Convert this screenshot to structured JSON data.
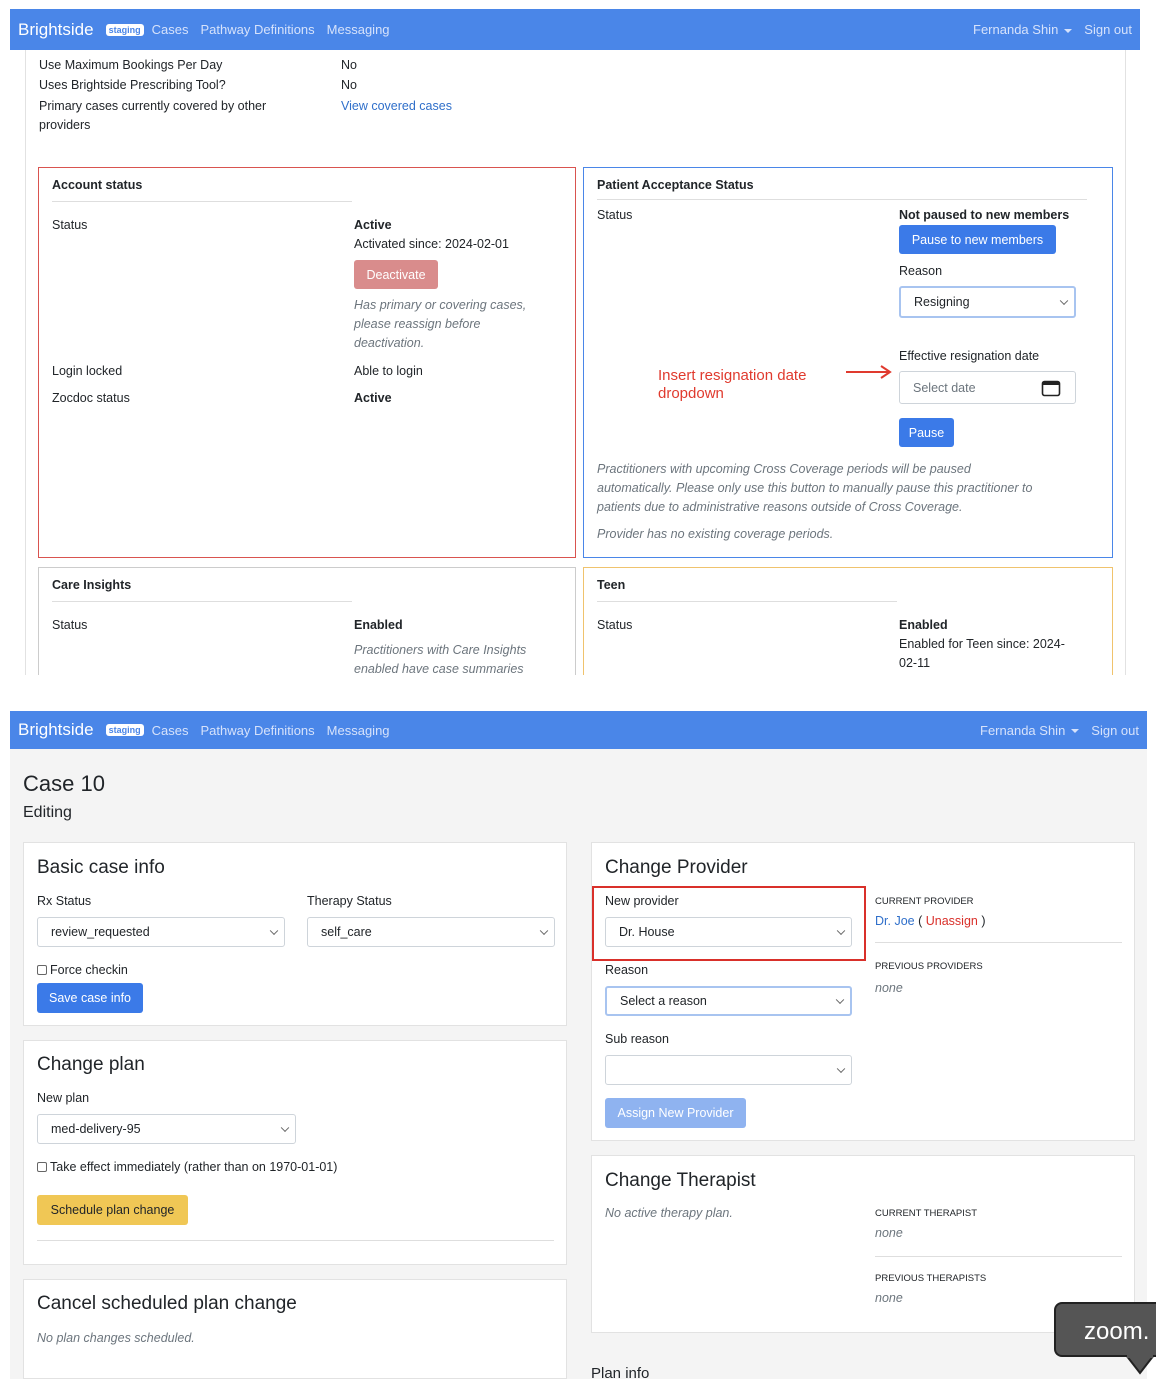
{
  "nav": {
    "brand": "Brightside",
    "env_badge": "staging",
    "links": [
      "Cases",
      "Pathway Definitions",
      "Messaging"
    ],
    "user": "Fernanda Shin",
    "sign_out": "Sign out"
  },
  "screen1": {
    "details": {
      "max_bookings_label": "Use Maximum Bookings Per Day",
      "max_bookings_value": "No",
      "prescribing_label": "Uses Brightside Prescribing Tool?",
      "prescribing_value": "No",
      "covered_label_1": "Primary cases currently covered by other",
      "covered_label_2": "providers",
      "covered_link": "View covered cases"
    },
    "account_status": {
      "title": "Account status",
      "status_label": "Status",
      "status_value": "Active",
      "activated_since": "Activated since: 2024-02-01",
      "deactivate_button": "Deactivate",
      "deactivate_note_1": "Has primary or covering cases,",
      "deactivate_note_2": "please reassign before",
      "deactivate_note_3": "deactivation.",
      "login_locked_label": "Login locked",
      "login_locked_value": "Able to login",
      "zocdoc_label": "Zocdoc status",
      "zocdoc_value": "Active"
    },
    "patient_acceptance": {
      "title": "Patient Acceptance Status",
      "status_label": "Status",
      "status_value": "Not paused to new members",
      "pause_new_button": "Pause to new members",
      "reason_label": "Reason",
      "reason_value": "Resigning",
      "date_label": "Effective resignation date",
      "date_placeholder": "Select date",
      "pause_button": "Pause",
      "annotation_1": "Insert resignation date",
      "annotation_2": "dropdown",
      "note_1": "Practitioners with upcoming Cross Coverage periods will be paused",
      "note_2": "automatically. Please only use this button to manually pause this practitioner to",
      "note_3": "patients due to administrative reasons outside of Cross Coverage.",
      "coverage_note": "Provider has no existing coverage periods."
    },
    "care_insights": {
      "title": "Care Insights",
      "status_label": "Status",
      "status_value": "Enabled",
      "note_1": "Practitioners with Care Insights",
      "note_2": "enabled have case summaries"
    },
    "teen": {
      "title": "Teen",
      "status_label": "Status",
      "status_value": "Enabled",
      "since_1": "Enabled for Teen since: 2024-",
      "since_2": "02-11"
    }
  },
  "screen2": {
    "page_title": "Case 10",
    "page_subtitle": "Editing",
    "basic_case_info": {
      "title": "Basic case info",
      "rx_label": "Rx Status",
      "rx_value": "review_requested",
      "therapy_label": "Therapy Status",
      "therapy_value": "self_care",
      "force_checkin": "Force checkin",
      "save_button": "Save case info"
    },
    "change_plan": {
      "title": "Change plan",
      "new_plan_label": "New plan",
      "new_plan_value": "med-delivery-95",
      "take_effect": "Take effect immediately (rather than on 1970-01-01)",
      "schedule_button": "Schedule plan change"
    },
    "cancel_plan": {
      "title": "Cancel scheduled plan change",
      "note": "No plan changes scheduled."
    },
    "change_provider": {
      "title": "Change Provider",
      "new_provider_label": "New provider",
      "new_provider_value": "Dr. House",
      "reason_label": "Reason",
      "reason_value": "Select a reason",
      "sub_reason_label": "Sub reason",
      "sub_reason_value": "",
      "assign_button": "Assign New Provider",
      "current_provider_label": "Current provider",
      "current_provider_name": "Dr. Joe",
      "unassign_link": "Unassign",
      "open_paren": "(",
      "close_paren": ")",
      "previous_providers_label": "Previous providers",
      "previous_providers_value": "none"
    },
    "change_therapist": {
      "title": "Change Therapist",
      "note": "No active therapy plan.",
      "current_label": "Current therapist",
      "current_value": "none",
      "previous_label": "Previous therapists",
      "previous_value": "none"
    },
    "plan_info_title": "Plan info"
  },
  "tooltip": "zoom."
}
